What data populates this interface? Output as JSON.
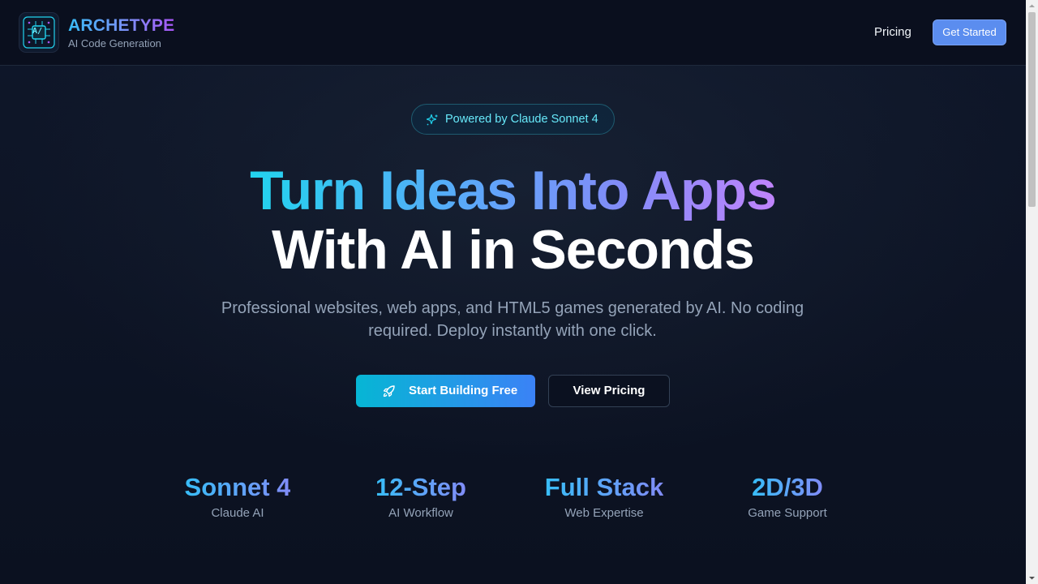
{
  "header": {
    "brand_name": "ARCHETYPE",
    "brand_tagline": "AI Code Generation",
    "logo_icon": "circuit-chip-icon",
    "logo_glyph": "A/",
    "nav_pricing": "Pricing",
    "cta_label": "Get Started"
  },
  "hero": {
    "badge_icon": "sparkle-icon",
    "badge_text": "Powered by Claude Sonnet 4",
    "headline_line1": "Turn Ideas Into Apps",
    "headline_line2": "With AI in Seconds",
    "subtitle": "Professional websites, web apps, and HTML5 games generated by AI. No coding required. Deploy instantly with one click.",
    "primary_button_icon": "rocket-icon",
    "primary_button": "Start Building Free",
    "secondary_button": "View Pricing"
  },
  "stats": [
    {
      "value": "Sonnet 4",
      "label": "Claude AI"
    },
    {
      "value": "12-Step",
      "label": "AI Workflow"
    },
    {
      "value": "Full Stack",
      "label": "Web Expertise"
    },
    {
      "value": "2D/3D",
      "label": "Game Support"
    }
  ],
  "colors": {
    "background": "#0b1120",
    "accent_cyan": "#22d3ee",
    "accent_blue": "#3b82f6",
    "accent_purple": "#a855f7",
    "muted_text": "#94a3b8"
  }
}
